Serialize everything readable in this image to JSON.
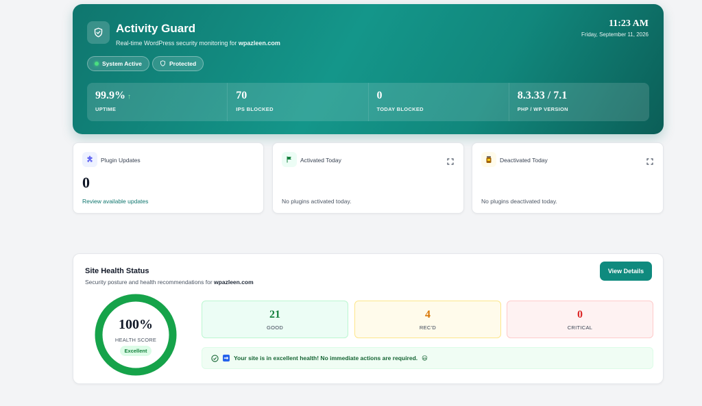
{
  "hero": {
    "title": "Activity Guard",
    "subtitle_prefix": "Real-time WordPress security monitoring for ",
    "site": "wpazleen.com",
    "time": "11:23 AM",
    "date": "Friday, September 11, 2026",
    "badges": [
      {
        "label": "System Active",
        "icon": "status-dot"
      },
      {
        "label": "Protected",
        "icon": "shield-icon"
      }
    ],
    "stats": [
      {
        "value": "99.9%",
        "trend": "↑",
        "label": "UPTIME"
      },
      {
        "value": "70",
        "label": "IPS BLOCKED"
      },
      {
        "value": "0",
        "label": "TODAY BLOCKED"
      },
      {
        "value": "8.3.33 / 7.1",
        "label": "PHP / WP VERSION"
      }
    ]
  },
  "cards": {
    "updates": {
      "title": "Plugin Updates",
      "count": "0",
      "link": "Review available updates",
      "icon": "puzzle-icon"
    },
    "activated": {
      "title": "Activated Today",
      "empty": "No plugins activated today.",
      "icon": "flag-icon"
    },
    "deactivated": {
      "title": "Deactivated Today",
      "empty": "No plugins deactivated today.",
      "icon": "jar-icon"
    }
  },
  "health": {
    "title": "Site Health Status",
    "subtitle_prefix": "Security posture and health recommendations for ",
    "site": "wpazleen.com",
    "button": "View Details",
    "score": "100%",
    "score_fraction": 1.0,
    "score_label": "HEALTH SCORE",
    "badge": "Excellent",
    "metrics": [
      {
        "value": "21",
        "label": "GOOD"
      },
      {
        "value": "4",
        "label": "REC'D"
      },
      {
        "value": "0",
        "label": "CRITICAL"
      }
    ],
    "message": "Your site is in excellent health! No immediate actions are required.",
    "message_emoji": "😃"
  },
  "colors": {
    "accent": "#0f8a7e",
    "good": "#16a34a",
    "warn": "#d97706",
    "critical": "#dc2626"
  }
}
